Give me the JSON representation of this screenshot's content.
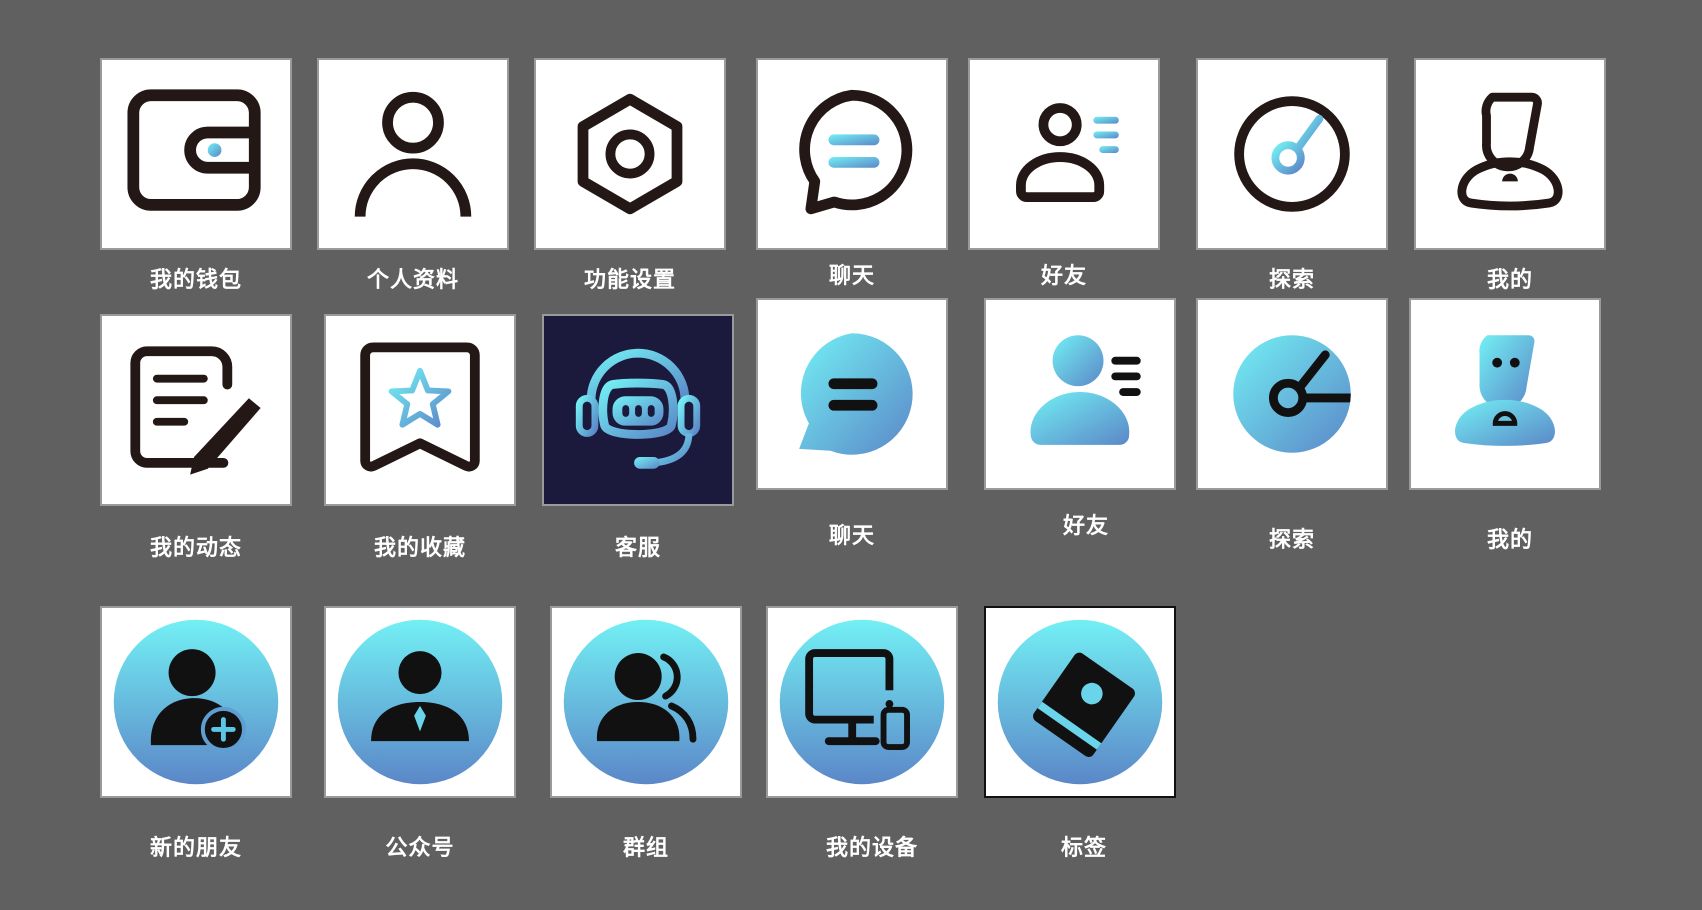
{
  "labels": {
    "wallet": "我的钱包",
    "profile": "个人资料",
    "settings": "功能设置",
    "chat_outline": "聊天",
    "friends_outline": "好友",
    "explore_outline": "探索",
    "me_outline": "我的",
    "moments": "我的动态",
    "favorites": "我的收藏",
    "customer_service": "客服",
    "chat_filled": "聊天",
    "friends_filled": "好友",
    "explore_filled": "探索",
    "me_filled": "我的",
    "new_friends": "新的朋友",
    "official_accounts": "公众号",
    "groups": "群组",
    "my_devices": "我的设备",
    "tags": "标签"
  },
  "icons": {
    "wallet": "wallet-icon",
    "profile": "person-icon",
    "settings": "hex-nut-icon",
    "chat_outline": "chat-bubble-icon",
    "friends_outline": "contacts-icon",
    "explore_outline": "compass-icon",
    "me_outline": "user-avatar-icon",
    "moments": "note-pencil-icon",
    "favorites": "bookmark-star-icon",
    "customer_service": "headset-robot-icon",
    "chat_filled": "chat-bubble-icon",
    "friends_filled": "contacts-icon",
    "explore_filled": "compass-icon",
    "me_filled": "user-avatar-icon",
    "new_friends": "add-user-icon",
    "official_accounts": "business-person-icon",
    "groups": "group-icon",
    "my_devices": "devices-icon",
    "tags": "tag-icon"
  },
  "colors": {
    "background": "#606060",
    "tile": "#ffffff",
    "dark_tile": "#1c1a3c",
    "icon_stroke": "#231815",
    "gradient_start": "#73f0f4",
    "gradient_end": "#5b87c8",
    "label": "#ffffff"
  }
}
